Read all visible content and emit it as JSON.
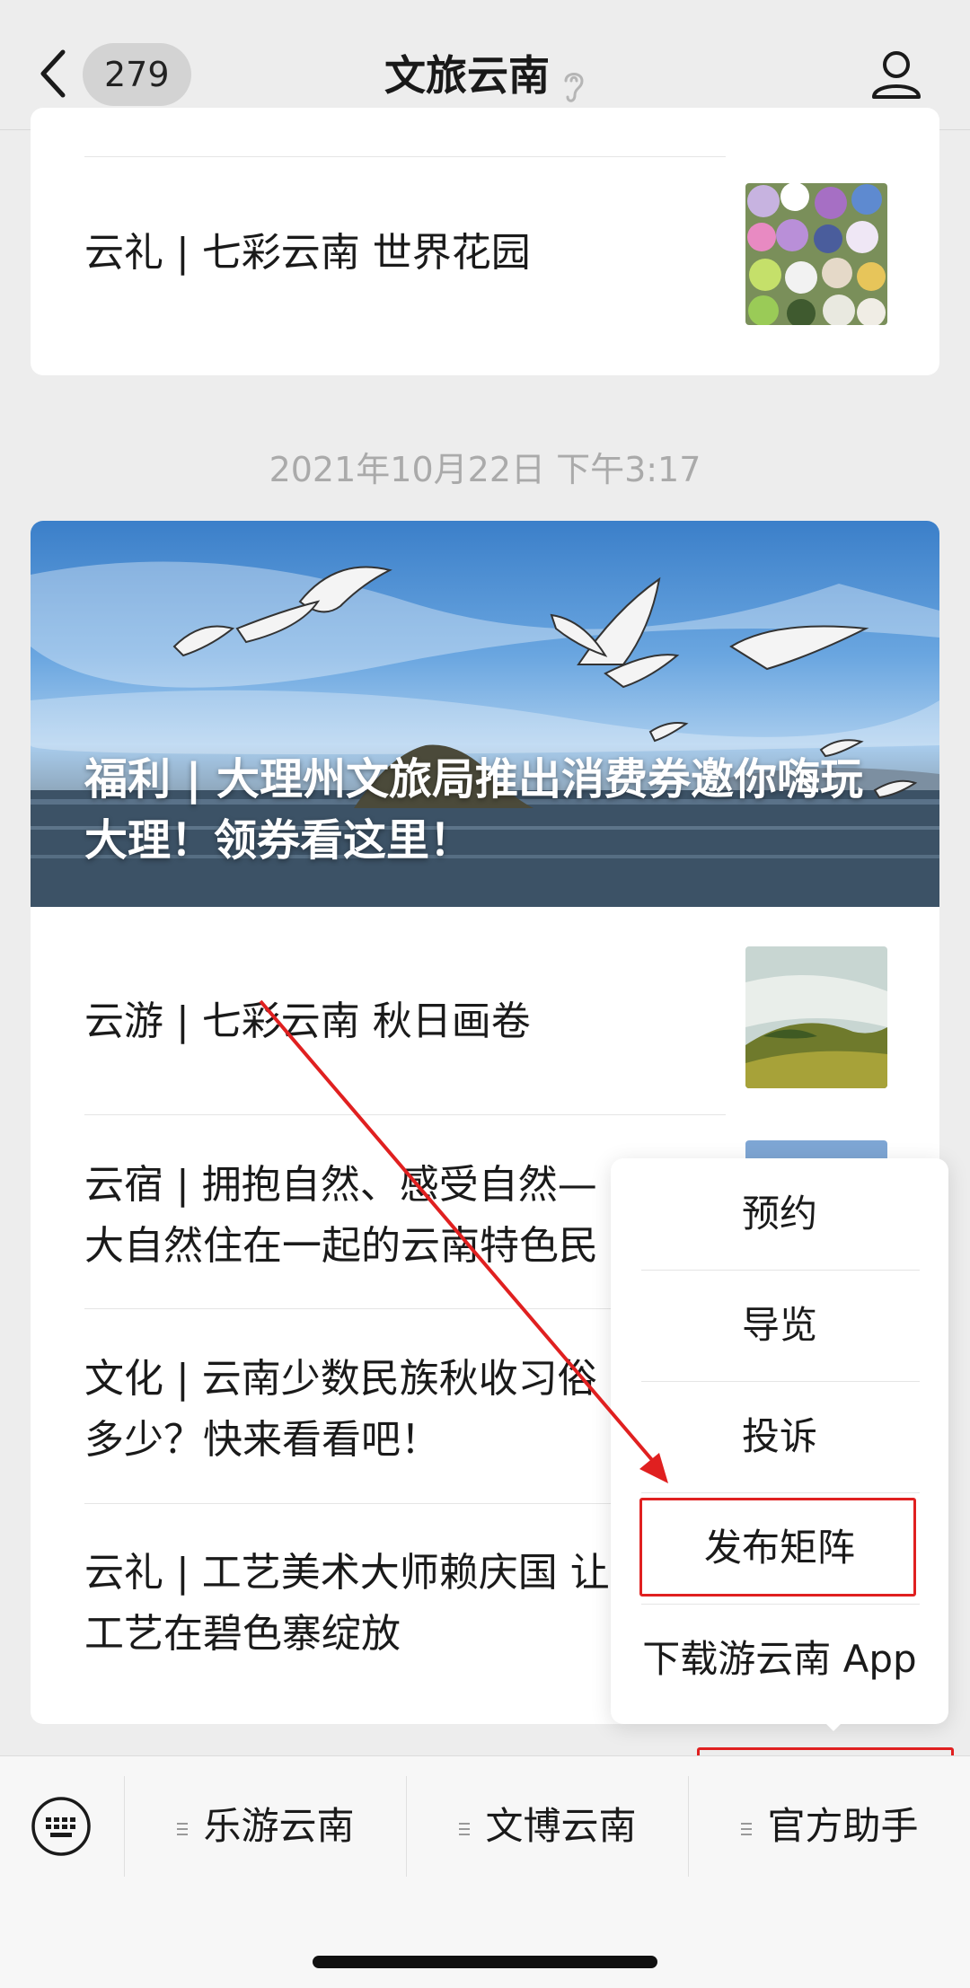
{
  "header": {
    "back_badge": "279",
    "title": "文旅云南"
  },
  "card1": {
    "row_text": "云礼 | 七彩云南 世界花园"
  },
  "timestamp": "2021年10月22日 下午3:17",
  "card2": {
    "hero_title": "福利 | 大理州文旅局推出消费券邀你嗨玩大理！领券看这里！",
    "rows": [
      {
        "line1": "云游 | 七彩云南 秋日画卷",
        "line2": ""
      },
      {
        "line1": "云宿 | 拥抱自然、感受自然—",
        "line2": "大自然住在一起的云南特色民"
      },
      {
        "line1": "文化 | 云南少数民族秋收习俗",
        "line2": "多少？快来看看吧！"
      },
      {
        "line1": "云礼 | 工艺美术大师赖庆国 让",
        "line2": "工艺在碧色寨绽放"
      }
    ]
  },
  "popup_menu": {
    "items": [
      "预约",
      "导览",
      "投诉",
      "发布矩阵",
      "下载游云南 App"
    ]
  },
  "bottom_tabs": [
    "乐游云南",
    "文博云南",
    "官方助手"
  ],
  "colors": {
    "annotation_red": "#e02020",
    "background": "#ededed"
  }
}
